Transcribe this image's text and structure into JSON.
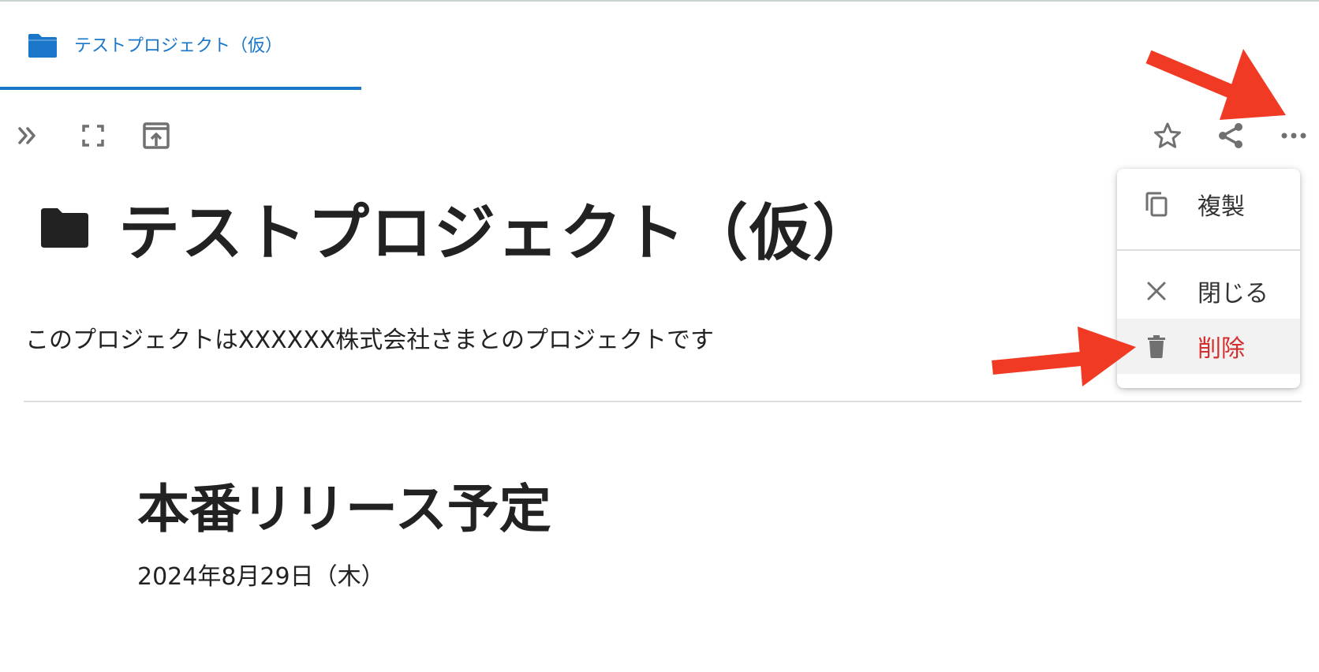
{
  "tab": {
    "label": "テストプロジェクト（仮）",
    "icon": "folder-icon",
    "color": "#1976c8"
  },
  "toolbar": {
    "left": [
      {
        "name": "expand-sidebar-button",
        "icon": "double-chevron-right-icon"
      },
      {
        "name": "fullscreen-button",
        "icon": "fullscreen-icon"
      },
      {
        "name": "open-in-window-button",
        "icon": "open-in-new-icon"
      }
    ],
    "right": [
      {
        "name": "favorite-button",
        "icon": "star-outline-icon"
      },
      {
        "name": "share-button",
        "icon": "share-icon"
      },
      {
        "name": "more-options-button",
        "icon": "more-horizontal-icon"
      }
    ]
  },
  "page": {
    "title": "テストプロジェクト（仮）",
    "title_icon": "folder-icon",
    "description": "このプロジェクトはXXXXXX株式会社さまとのプロジェクトです"
  },
  "section": {
    "heading": "本番リリース予定",
    "date": "2024年8月29日（木）"
  },
  "menu": {
    "items": [
      {
        "label": "複製",
        "icon": "copy-icon"
      },
      {
        "label": "閉じる",
        "icon": "close-icon"
      },
      {
        "label": "削除",
        "icon": "trash-icon",
        "danger_color": "#d32f2f"
      }
    ]
  },
  "annotations": {
    "arrow_color": "#f03a24"
  }
}
